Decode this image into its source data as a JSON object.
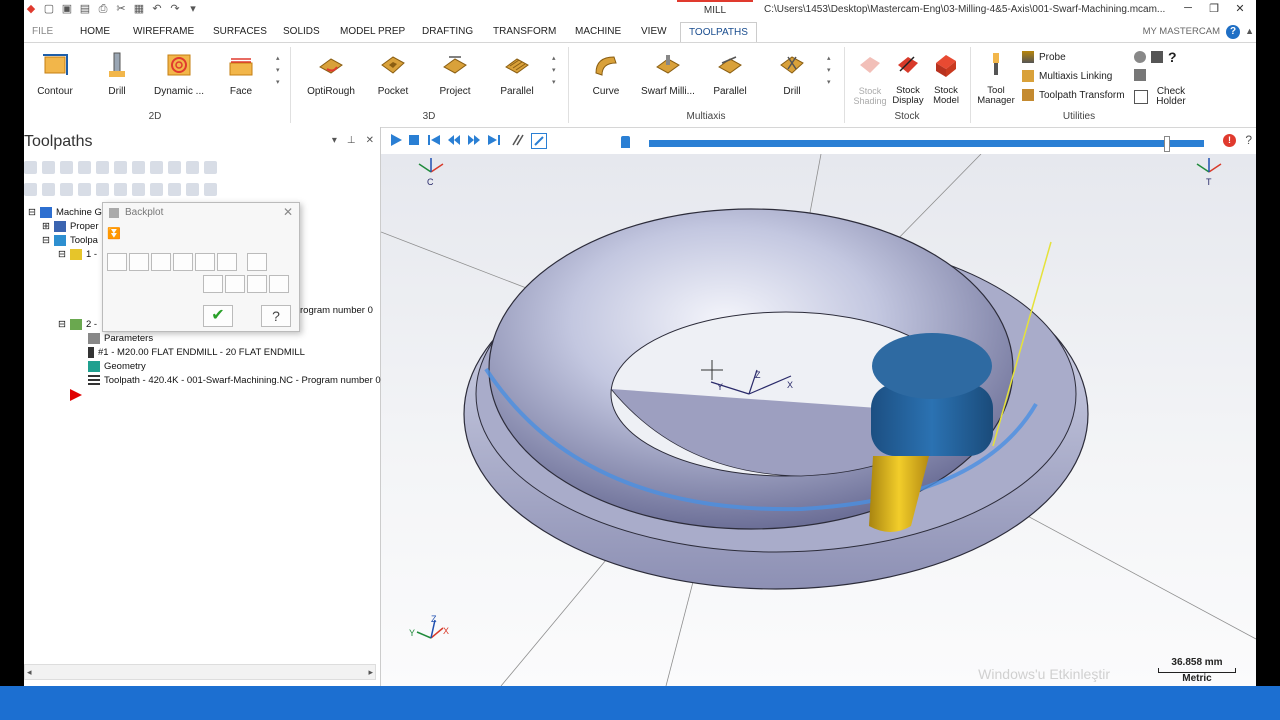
{
  "title_bar": {
    "context_tab": "MILL",
    "file_path": "C:\\Users\\1453\\Desktop\\Mastercam-Eng\\03-Milling-4&5-Axis\\001-Swarf-Machining.mcam..."
  },
  "menu": {
    "tabs": [
      "FILE",
      "HOME",
      "WIREFRAME",
      "SURFACES",
      "SOLIDS",
      "MODEL PREP",
      "DRAFTING",
      "TRANSFORM",
      "MACHINE",
      "VIEW",
      "TOOLPATHS"
    ],
    "active": "TOOLPATHS",
    "my_mastercam": "MY MASTERCAM"
  },
  "ribbon": {
    "groups": {
      "g2d": "2D",
      "g3d": "3D",
      "multiaxis": "Multiaxis",
      "stock": "Stock",
      "utilities": "Utilities"
    },
    "buttons_2d": [
      "Contour",
      "Drill",
      "Dynamic ...",
      "Face"
    ],
    "buttons_3d": [
      "OptiRough",
      "Pocket",
      "Project",
      "Parallel"
    ],
    "buttons_multiaxis": [
      "Curve",
      "Swarf Milli...",
      "Parallel",
      "Drill"
    ],
    "stock_shading": "Stock Shading",
    "stock_display": "Stock Display",
    "stock_model": "Stock Model",
    "tool_manager": "Tool Manager",
    "probe": "Probe",
    "multiaxis_linking": "Multiaxis Linking",
    "toolpath_transform": "Toolpath Transform",
    "check_holder": "Check Holder"
  },
  "panel": {
    "title": "Toolpaths",
    "tree": {
      "machine_group": "Machine Gr",
      "properties": "Proper",
      "toolpath_group": "Toolpa",
      "op1_num": "1 -",
      "op1_toolpath_tail": "rogram number 0",
      "op2_num": "2 -",
      "parameters": "Parameters",
      "tool": "#1 - M20.00 FLAT ENDMILL - 20 FLAT ENDMILL",
      "geometry": "Geometry",
      "toolpath": "Toolpath - 420.4K - 001-Swarf-Machining.NC - Program number 0"
    }
  },
  "backplot": {
    "title": "Backplot"
  },
  "viewport": {
    "scale_value": "36.858 mm",
    "scale_unit": "Metric",
    "watermark": "Windows'u Etkinleştir",
    "triad_labels": {
      "x": "X",
      "y": "Y",
      "z": "Z"
    },
    "corner_left": "C",
    "corner_right": "T"
  },
  "colors": {
    "accent_blue": "#2a7fd4",
    "mill_tab_red": "#e03a2e",
    "taskbar": "#1c6fd1",
    "tool_body": "#1f5e93",
    "tool_shank": "#e3b81a"
  }
}
